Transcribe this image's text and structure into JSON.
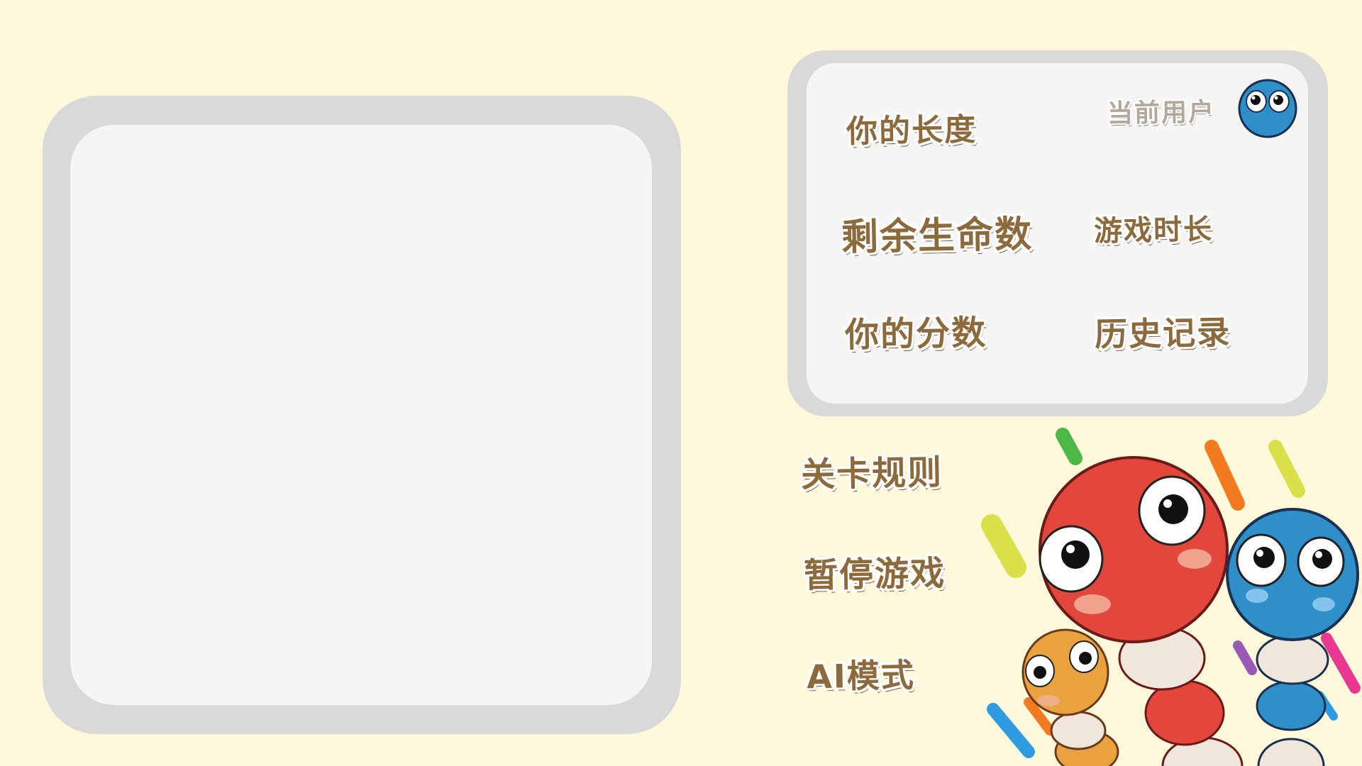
{
  "info_panel": {
    "length_label": "你的长度",
    "lives_label": "剩余生命数",
    "time_label": "游戏时长",
    "score_label": "你的分数",
    "history_label": "历史记录",
    "user_label": "当前用户"
  },
  "controls": {
    "rules_label": "关卡规则",
    "pause_label": "暂停游戏",
    "ai_label": "AI模式"
  },
  "colors": {
    "background": "#fff9db",
    "frame": "#d9d9d9",
    "panel": "#f5f5f5",
    "label_text": "#8c6a3c",
    "snake_red": "#e3463a",
    "snake_blue": "#2f8fc9",
    "snake_orange": "#e9a23e"
  },
  "icons": {
    "avatar": "blue-snake-face-icon",
    "illustration": "snake-mascots"
  }
}
